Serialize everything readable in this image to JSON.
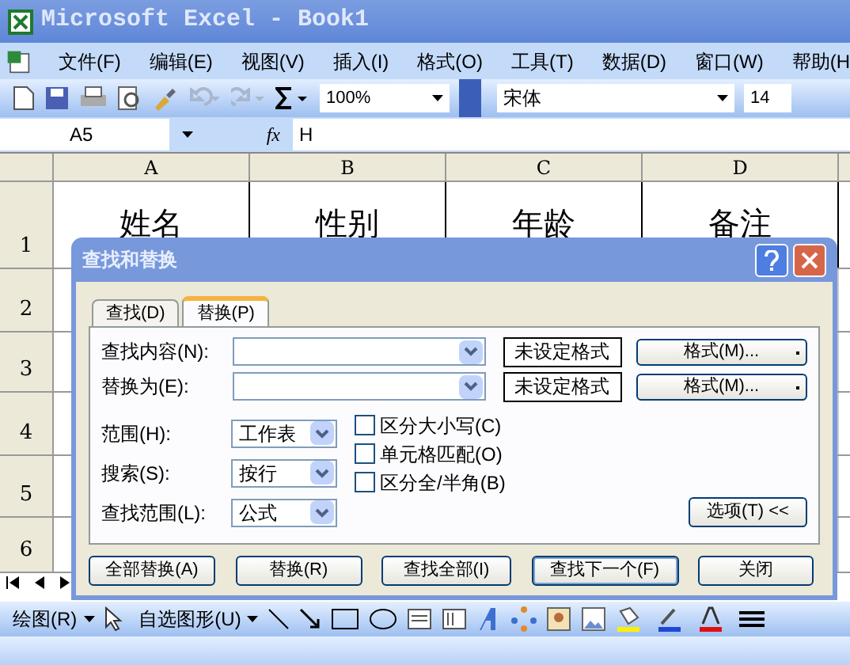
{
  "window": {
    "title": "Microsoft Excel - Book1"
  },
  "menu": [
    "文件(F)",
    "编辑(E)",
    "视图(V)",
    "插入(I)",
    "格式(O)",
    "工具(T)",
    "数据(D)",
    "窗口(W)",
    "帮助(H"
  ],
  "toolbar": {
    "zoom": "100%",
    "font": "宋体",
    "size": "14"
  },
  "formula_bar": {
    "name_box": "A5",
    "fx": "fx",
    "value": "H"
  },
  "sheet": {
    "columns": [
      "A",
      "B",
      "C",
      "D"
    ],
    "rows": [
      "1",
      "2",
      "3",
      "4",
      "5",
      "6"
    ],
    "cells": [
      "姓名",
      "性别",
      "年龄",
      "备注"
    ]
  },
  "dialog": {
    "title": "查找和替换",
    "tabs": [
      {
        "label": "查找(D)",
        "selected": false
      },
      {
        "label": "替换(P)",
        "selected": true
      }
    ],
    "fields": [
      {
        "label": "查找内容(N):",
        "format_status": "未设定格式",
        "format_button": "格式(M)..."
      },
      {
        "label": "替换为(E):",
        "format_status": "未设定格式",
        "format_button": "格式(M)..."
      }
    ],
    "options": [
      {
        "label": "范围(H):",
        "value": "工作表"
      },
      {
        "label": "搜索(S):",
        "value": "按行"
      },
      {
        "label": "查找范围(L):",
        "value": "公式"
      }
    ],
    "checkboxes": [
      {
        "label": "区分大小写(C)",
        "checked": false
      },
      {
        "label": "单元格匹配(O)",
        "checked": false
      },
      {
        "label": "区分全/半角(B)",
        "checked": false
      }
    ],
    "options_button": "选项(T) <<",
    "buttons": [
      {
        "label": "全部替换(A)",
        "selected": false
      },
      {
        "label": "替换(R)",
        "selected": false
      },
      {
        "label": "查找全部(I)",
        "selected": false
      },
      {
        "label": "查找下一个(F)",
        "selected": true
      },
      {
        "label": "关闭",
        "selected": false
      }
    ]
  },
  "drawing_toolbar": {
    "draw": "绘图(R)",
    "autoshapes": "自选图形(U)"
  }
}
